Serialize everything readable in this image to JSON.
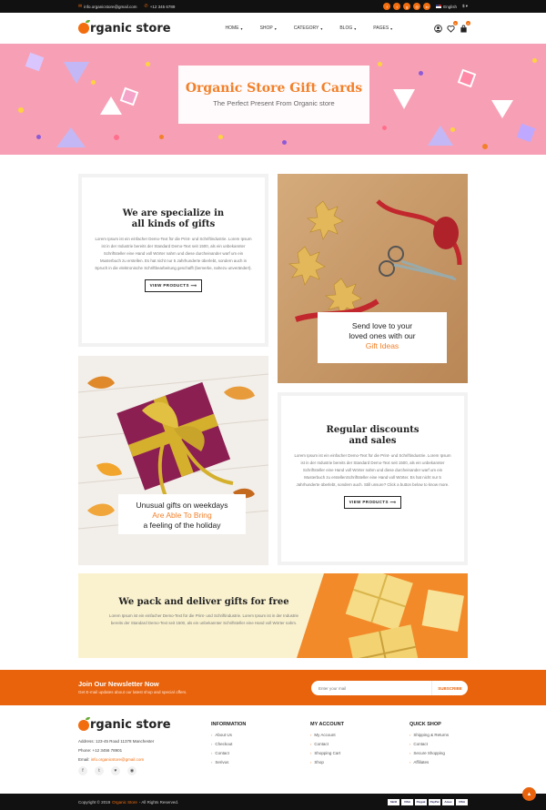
{
  "topbar": {
    "email": "info.organicstore@gmail.com",
    "phone": "+12 345 6789",
    "social_icons": [
      "facebook-icon",
      "twitter-icon",
      "google-plus-icon",
      "instagram-icon",
      "linkedin-icon"
    ],
    "language": "English",
    "currency": "$"
  },
  "header": {
    "logo_text": "rganic store",
    "nav": [
      {
        "label": "HOME"
      },
      {
        "label": "SHOP"
      },
      {
        "label": "CATEGORY"
      },
      {
        "label": "BLOG"
      },
      {
        "label": "PAGES"
      }
    ],
    "cart_count": "0",
    "wishlist_count": "0"
  },
  "hero": {
    "title": "Organic Store Gift Cards",
    "subtitle": "The Perfect Present From Organic store"
  },
  "blocks": {
    "specialize": {
      "title_line1": "We are specialize in",
      "title_line2": "all kinds of gifts",
      "body": "Lorem Ipsum ist ein einfacher Demo-Text für die Print- und Schriftindustrie. Lorem Ipsum ist in der Industrie bereits der Standard Demo-Text seit 1500, als ein unbekannter Schriftsteller eine Hand voll Wörter nahm und diese durcheinander warf um ein Musterbuch zu erstellen. Es hat nicht nur 5 Jahrhunderte überlebt, sondern auch in Spruch in die elektronische Schriftbearbeitung geschafft (bemerke, nahezu unverändert).",
      "button": "VIEW PRODUCTS"
    },
    "send_love": {
      "line1": "Send love to your",
      "line2": "loved ones with our",
      "highlight": "Gift Ideas"
    },
    "unusual": {
      "line1": "Unusual gifts on weekdays",
      "highlight": "Are Able To Bring",
      "line3": "a feeling of the holiday"
    },
    "discounts": {
      "title_line1": "Regular discounts",
      "title_line2": "and sales",
      "body": "Lorem Ipsum ist ein einfacher Demo-Text für die Print- und Schriftindustrie. Lorem Ipsum ist in der Industrie bereits der Standard Demo-Text seit 1500, als ein unbekannter Schriftsteller eine Hand voll Wörter nahm und diese durcheinander warf um ein Musterbuch zu erstellenSchriftsteller eine Hand voll Wörter. Es hat nicht nur 5 Jahrhunderte überlebt, sondern auch. Still unsure? Click a button below to know more.",
      "button": "VIEW PRODUCTS"
    },
    "deliver": {
      "title": "We pack and deliver gifts for free",
      "body": "Lorem Ipsum ist ein einfacher Demo-Text für die Print- und Schriftindustrie. Lorem Ipsum ist in der Industrie bereits der Standard Demo-Text seit 1500, als ein unbekannter Schriftsteller eine Hand voll Wörter nahm."
    }
  },
  "newsletter": {
    "title": "Join Our Newsletter Now",
    "subtitle": "Get E-mail updates about our latest shop and special offers.",
    "placeholder": "Enter your mail",
    "button": "SUBSCRIBE"
  },
  "footer": {
    "logo_text": "rganic store",
    "address": "Address: 123-45 Road 11378 Manchester",
    "phone": "Phone: +12 3456 78901",
    "email_label": "Email:",
    "email": "info.organicstore@gmail.com",
    "social_icons": [
      "facebook-icon",
      "twitter-icon",
      "twitter-bird-icon",
      "dribbble-icon"
    ],
    "columns": [
      {
        "title": "INFORMATION",
        "links": [
          "About Us",
          "Checkout",
          "Contact",
          "Serivus"
        ]
      },
      {
        "title": "MY ACCOUNT",
        "links": [
          "My Account",
          "Contact",
          "Shopping Cart",
          "Shop"
        ]
      },
      {
        "title": "QUICK SHOP",
        "links": [
          "Shipping & Returns",
          "Contact",
          "Secure Shopping",
          "Affiliates"
        ]
      }
    ],
    "copyright_prefix": "Copyright © 2019",
    "copyright_brand": "Organic Store",
    "copyright_suffix": "- All Rights Reserved.",
    "payments": [
      "Skrill",
      "VISA",
      "Paypal",
      "PayPal",
      "Amex",
      "VISA"
    ]
  },
  "colors": {
    "accent": "#f26d0e",
    "hero_bg": "#f7a0b5",
    "newsletter_bg": "#e8630c"
  }
}
